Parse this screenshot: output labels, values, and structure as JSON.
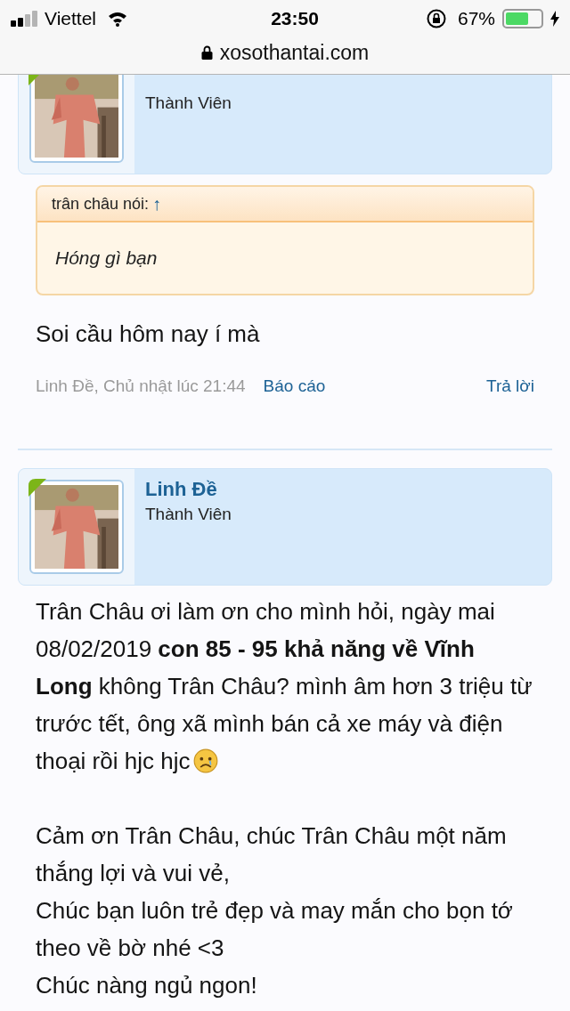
{
  "status_bar": {
    "carrier": "Viettel",
    "time": "23:50",
    "battery": "67%",
    "charging": true
  },
  "address_bar": {
    "url": "xosothantai.com"
  },
  "posts": [
    {
      "author": {
        "role": "Thành Viên",
        "online": true
      },
      "quote": {
        "header": "trân châu nói:",
        "arrow": "↑",
        "text": "Hóng gì bạn"
      },
      "paragraphs": [
        {
          "lines": [
            "Soi cầu hôm nay í mà"
          ],
          "emoji": false
        }
      ],
      "meta": {
        "byline": "Linh Đề, Chủ nhật lúc 21:44",
        "report": "Báo cáo",
        "reply": "Trả lời"
      }
    },
    {
      "author": {
        "name": "Linh Đề",
        "role": "Thành Viên",
        "online": true
      },
      "paragraphs": [
        {
          "lines": [
            "Trân Châu ơi làm ơn cho mình hỏi, ngày mai 08/02/2019 **con 85 - 95 khả năng về Vĩnh Long** không Trân Châu? mình âm hơn 3 triệu từ trước tết, ông xã mình bán cả xe máy và điện thoại rồi hjc hjc"
          ],
          "emoji": true
        },
        {
          "lines": [
            "Cảm ơn Trân Châu, chúc Trân Châu một năm thắng lợi và vui vẻ,",
            "Chúc bạn luôn trẻ đẹp và may mắn cho bọn tớ theo về bờ nhé <3",
            "Chúc nàng ngủ ngon!"
          ],
          "emoji": false
        }
      ]
    }
  ]
}
